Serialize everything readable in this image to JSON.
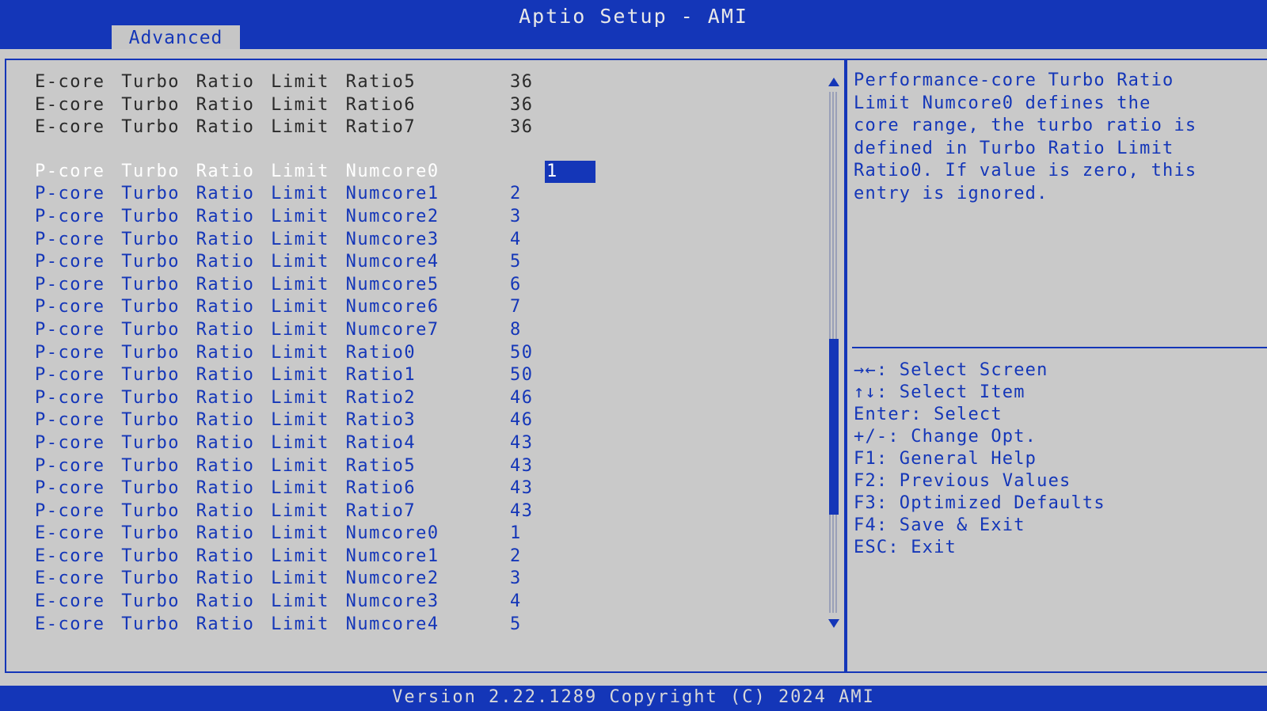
{
  "header": {
    "title": "Aptio Setup - AMI",
    "active_tab": "Advanced"
  },
  "settings": [
    {
      "label": "E-core Turbo Ratio Limit Ratio5",
      "value": "36",
      "type": "readonly"
    },
    {
      "label": "E-core Turbo Ratio Limit Ratio6",
      "value": "36",
      "type": "readonly"
    },
    {
      "label": "E-core Turbo Ratio Limit Ratio7",
      "value": "36",
      "type": "readonly"
    },
    {
      "label": "P-core Turbo Ratio Limit Numcore0",
      "value": "1",
      "type": "editable",
      "selected": true
    },
    {
      "label": "P-core Turbo Ratio Limit Numcore1",
      "value": "2",
      "type": "editable"
    },
    {
      "label": "P-core Turbo Ratio Limit Numcore2",
      "value": "3",
      "type": "editable"
    },
    {
      "label": "P-core Turbo Ratio Limit Numcore3",
      "value": "4",
      "type": "editable"
    },
    {
      "label": "P-core Turbo Ratio Limit Numcore4",
      "value": "5",
      "type": "editable"
    },
    {
      "label": "P-core Turbo Ratio Limit Numcore5",
      "value": "6",
      "type": "editable"
    },
    {
      "label": "P-core Turbo Ratio Limit Numcore6",
      "value": "7",
      "type": "editable"
    },
    {
      "label": "P-core Turbo Ratio Limit Numcore7",
      "value": "8",
      "type": "editable"
    },
    {
      "label": "P-core Turbo Ratio Limit Ratio0",
      "value": "50",
      "type": "editable"
    },
    {
      "label": "P-core Turbo Ratio Limit Ratio1",
      "value": "50",
      "type": "editable"
    },
    {
      "label": "P-core Turbo Ratio Limit Ratio2",
      "value": "46",
      "type": "editable"
    },
    {
      "label": "P-core Turbo Ratio Limit Ratio3",
      "value": "46",
      "type": "editable"
    },
    {
      "label": "P-core Turbo Ratio Limit Ratio4",
      "value": "43",
      "type": "editable"
    },
    {
      "label": "P-core Turbo Ratio Limit Ratio5",
      "value": "43",
      "type": "editable"
    },
    {
      "label": "P-core Turbo Ratio Limit Ratio6",
      "value": "43",
      "type": "editable"
    },
    {
      "label": "P-core Turbo Ratio Limit Ratio7",
      "value": "43",
      "type": "editable"
    },
    {
      "label": "E-core Turbo Ratio Limit Numcore0",
      "value": "1",
      "type": "editable"
    },
    {
      "label": "E-core Turbo Ratio Limit Numcore1",
      "value": "2",
      "type": "editable"
    },
    {
      "label": "E-core Turbo Ratio Limit Numcore2",
      "value": "3",
      "type": "editable"
    },
    {
      "label": "E-core Turbo Ratio Limit Numcore3",
      "value": "4",
      "type": "editable"
    },
    {
      "label": "E-core Turbo Ratio Limit Numcore4",
      "value": "5",
      "type": "editable"
    }
  ],
  "help": {
    "lines": [
      "Performance-core Turbo Ratio",
      "Limit Numcore0 defines the",
      "core range, the turbo ratio is",
      "defined in Turbo Ratio Limit",
      "Ratio0. If value is zero, this",
      "entry is ignored."
    ]
  },
  "keys": [
    "→←: Select Screen",
    "↑↓: Select Item",
    "Enter: Select",
    "+/-: Change Opt.",
    "F1: General Help",
    "F2: Previous Values",
    "F3: Optimized Defaults",
    "F4: Save & Exit",
    "ESC: Exit"
  ],
  "footer": {
    "text": "Version 2.22.1289 Copyright (C) 2024 AMI"
  },
  "colors": {
    "accent_blue": "#1436b8",
    "background_gray": "#c9c9c9",
    "readonly_text": "#2a2a2a",
    "selected_text": "#ffffff"
  },
  "icons": {
    "scroll_up": "scroll-up-arrow-icon",
    "scroll_down": "scroll-down-arrow-icon"
  }
}
